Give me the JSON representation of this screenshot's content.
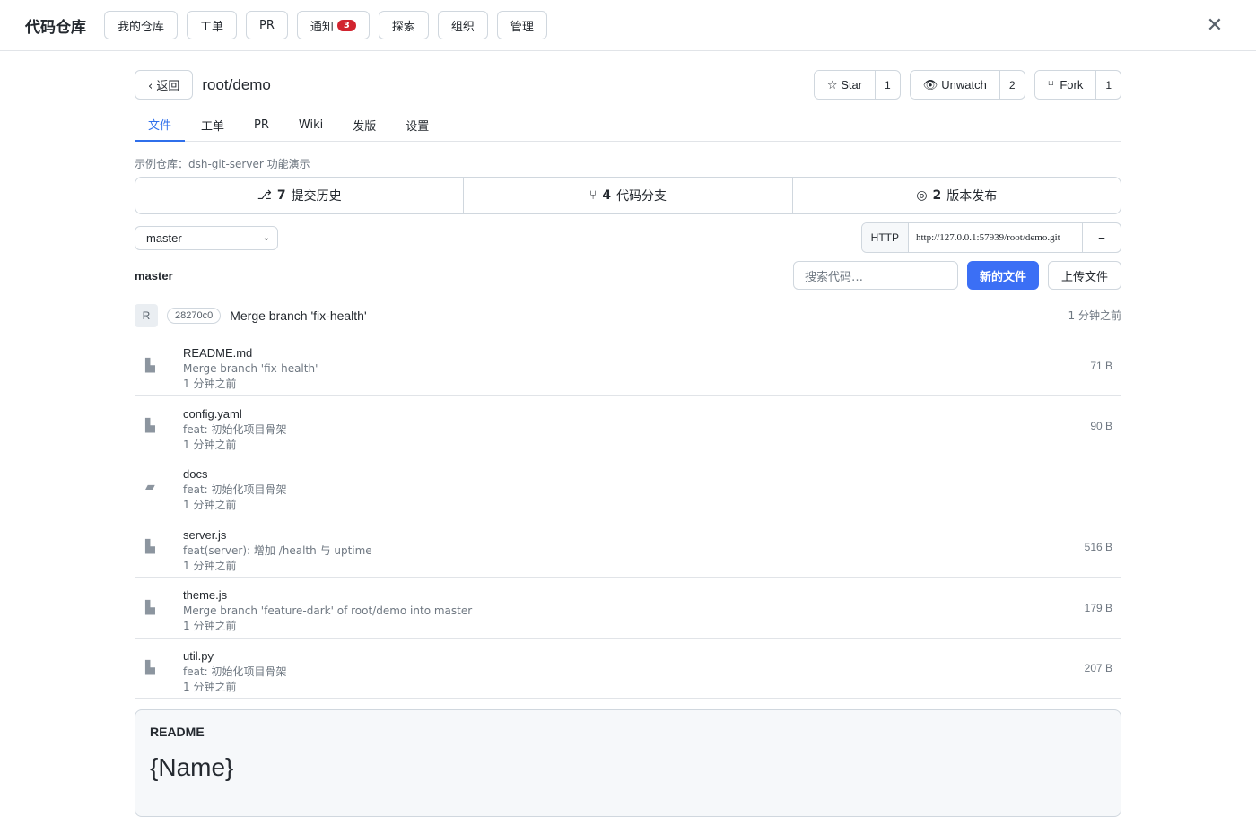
{
  "app": {
    "brand": "代码仓库",
    "nav": [
      "我的仓库",
      "工单",
      "PR",
      "通知",
      "探索",
      "组织",
      "管理"
    ],
    "notify_count": "3",
    "close": "✕"
  },
  "repo": {
    "back_label": "‹ 返回",
    "name": "root/demo",
    "star_label": "☆ Star",
    "star_count": "1",
    "watch_label": "Unwatch",
    "watch_count": "2",
    "fork_label": "Fork",
    "fork_count": "1",
    "tabs": [
      "文件",
      "工单",
      "PR",
      "Wiki",
      "发版",
      "设置"
    ],
    "description": "示例仓库：dsh-git-server 功能演示",
    "stats": [
      {
        "icon": "⎇",
        "count": "7",
        "label": "提交历史"
      },
      {
        "icon": "⑂",
        "count": "4",
        "label": "代码分支"
      },
      {
        "icon": "◎",
        "count": "2",
        "label": "版本发布"
      }
    ],
    "branch": "master",
    "clone_protocol": "HTTP",
    "clone_url": "http://127.0.0.1:57939/root/demo.git",
    "current_branch_label": "master",
    "search_placeholder": "搜索代码…",
    "new_file_label": "新的文件",
    "upload_label": "上传文件"
  },
  "last_commit": {
    "avatar": "R",
    "sha": "28270c0",
    "message": "Merge branch 'fix-health'",
    "time": "1 分钟之前"
  },
  "files": [
    {
      "name": "README.md",
      "message": "Merge branch 'fix-health'",
      "time": "1 分钟之前",
      "size": "71 B",
      "type": "file"
    },
    {
      "name": "config.yaml",
      "message": "feat: 初始化项目骨架",
      "time": "1 分钟之前",
      "size": "90 B",
      "type": "file"
    },
    {
      "name": "docs",
      "message": "feat: 初始化项目骨架",
      "time": "1 分钟之前",
      "size": "",
      "type": "folder"
    },
    {
      "name": "server.js",
      "message": "feat(server): 增加 /health 与 uptime",
      "time": "1 分钟之前",
      "size": "516 B",
      "type": "file"
    },
    {
      "name": "theme.js",
      "message": "Merge branch 'feature-dark' of root/demo into master",
      "time": "1 分钟之前",
      "size": "179 B",
      "type": "file"
    },
    {
      "name": "util.py",
      "message": "feat: 初始化项目骨架",
      "time": "1 分钟之前",
      "size": "207 B",
      "type": "file"
    }
  ],
  "readme": {
    "title": "README",
    "heading": "{Name}"
  }
}
